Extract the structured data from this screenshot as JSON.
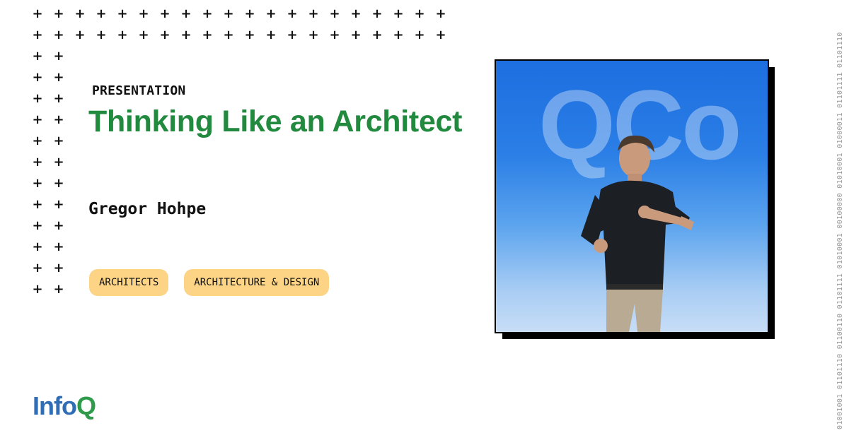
{
  "eyebrow": "PRESENTATION",
  "title": "Thinking Like an Architect",
  "speaker": "Gregor Hohpe",
  "tags": [
    "ARCHITECTS",
    "ARCHITECTURE & DESIGN"
  ],
  "photo": {
    "backdrop_text": "QCo"
  },
  "logo": {
    "part1": "Info",
    "part2": "Q"
  },
  "binary_strip": "01001001 01101110 01100110 01101111 01010001 00100000 01010001 01000011 01101111 01101110",
  "colors": {
    "title": "#218a3f",
    "tag_bg": "#fdd486",
    "logo_blue": "#2f6db5",
    "logo_green": "#2e9a4a"
  }
}
